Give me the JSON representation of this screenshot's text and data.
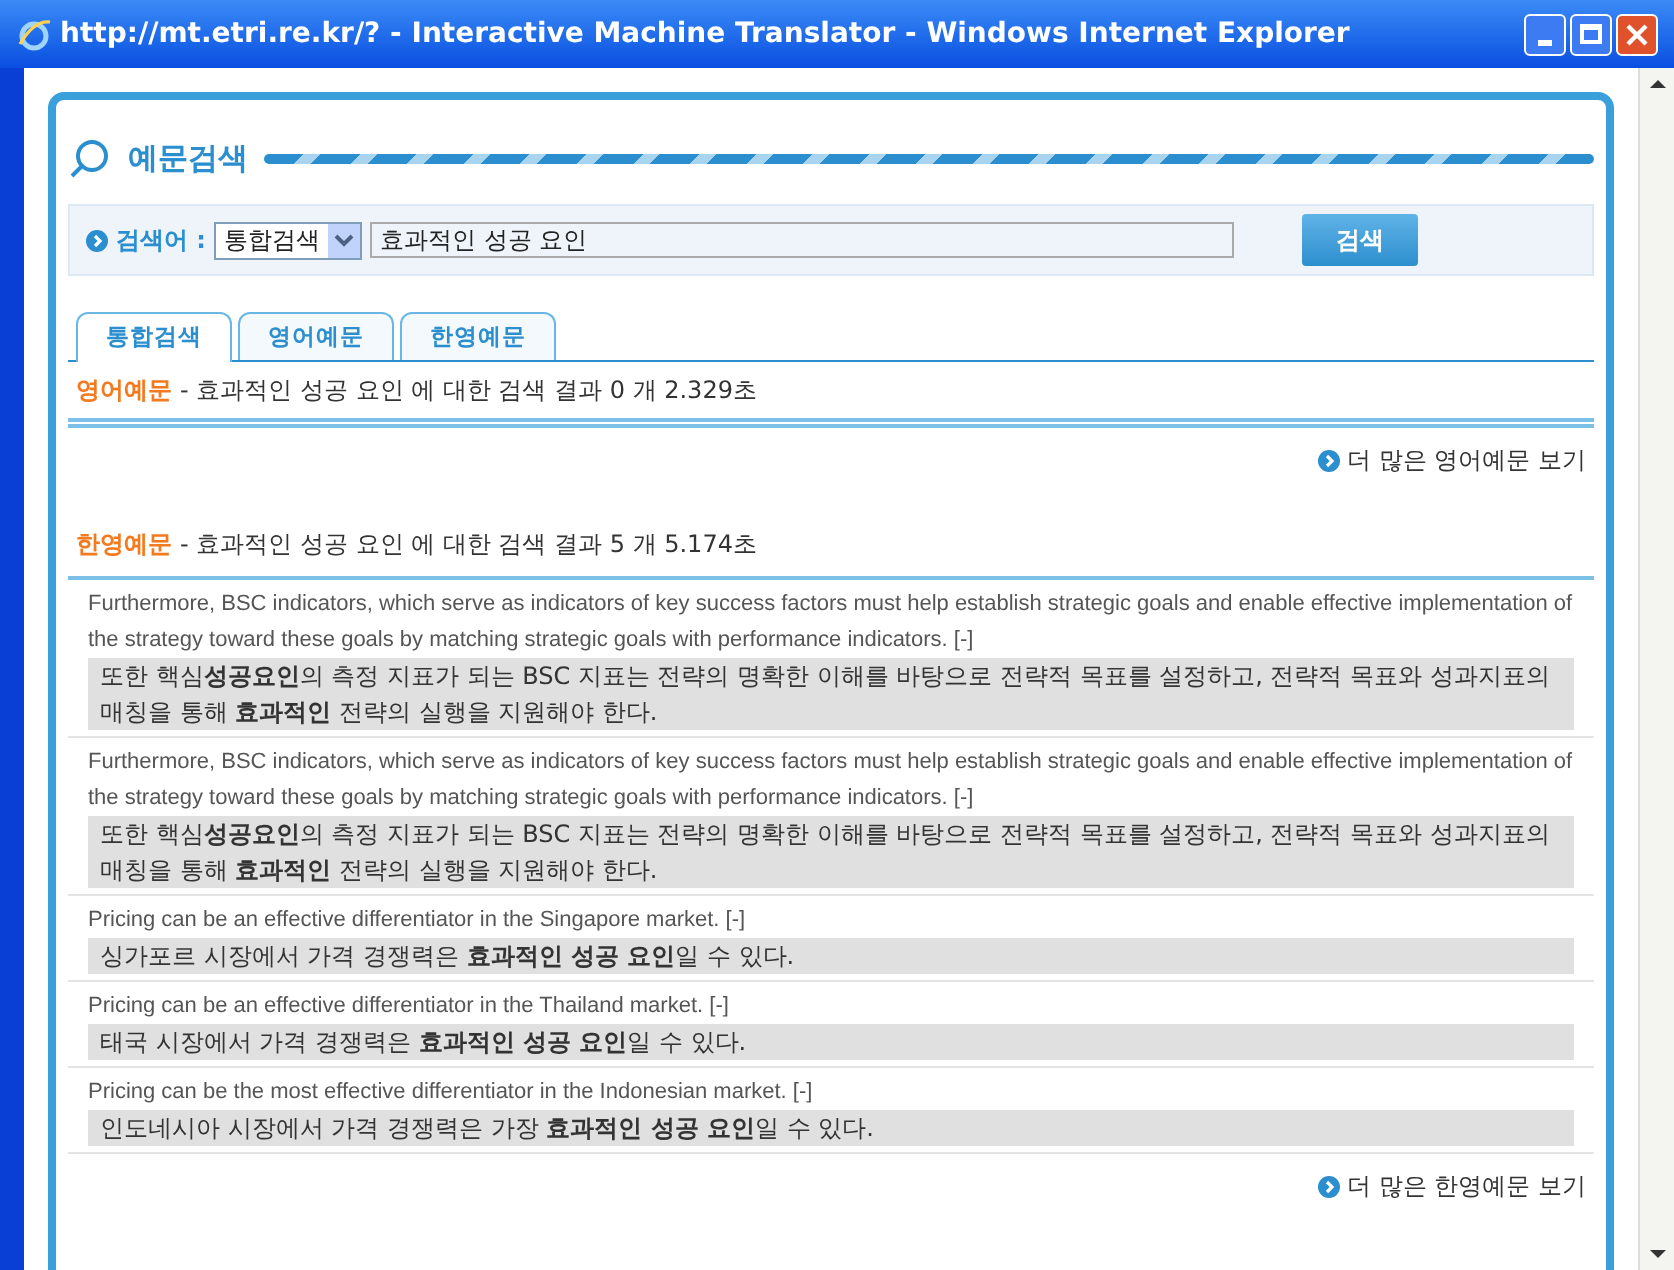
{
  "window": {
    "title": "http://mt.etri.re.kr/? - Interactive Machine Translator - Windows Internet Explorer"
  },
  "panel_title": "예문검색",
  "search": {
    "label": "검색어 :",
    "scope": "통합검색",
    "query": "효과적인 성공 요인",
    "button": "검색"
  },
  "tabs": [
    {
      "label": "통합검색",
      "selected": true
    },
    {
      "label": "영어예문",
      "selected": false
    },
    {
      "label": "한영예문",
      "selected": false
    }
  ],
  "sections": [
    {
      "title": "영어예문",
      "summary": "- 효과적인 성공 요인 에 대한 검색 결과 0 개 2.329초",
      "more": "더 많은 영어예문 보기"
    },
    {
      "title": "한영예문",
      "summary": "- 효과적인 성공 요인 에 대한 검색 결과 5 개 5.174초",
      "results": [
        {
          "english": "Furthermore, BSC indicators, which serve as indicators of key success factors must help establish strategic goals and enable effective implementation of the strategy toward these goals by matching strategic goals with performance indicators.",
          "toggle": "[-]",
          "korean": "또한 핵심**성공요인**의 측정 지표가 되는 BSC 지표는 전략의 명확한 이해를 바탕으로 전략적 목표를 설정하고, 전략적 목표와 성과지표의 매칭을 통해 **효과적인** 전략의 실행을 지원해야 한다."
        },
        {
          "english": "Furthermore, BSC indicators, which serve as indicators of key success factors must help establish strategic goals and enable effective implementation of the strategy toward these goals by matching strategic goals with performance indicators.",
          "toggle": "[-]",
          "korean": "또한 핵심**성공요인**의 측정 지표가 되는 BSC 지표는 전략의 명확한 이해를 바탕으로 전략적 목표를 설정하고, 전략적 목표와 성과지표의 매칭을 통해 **효과적인** 전략의 실행을 지원해야 한다."
        },
        {
          "english": "Pricing can be an effective differentiator in the Singapore market.",
          "toggle": "[-]",
          "korean": "싱가포르 시장에서 가격 경쟁력은 **효과적인 성공 요인**일 수 있다."
        },
        {
          "english": "Pricing can be an effective differentiator in the Thailand market.",
          "toggle": "[-]",
          "korean": "태국 시장에서 가격 경쟁력은 **효과적인 성공 요인**일 수 있다."
        },
        {
          "english": "Pricing can be the most effective differentiator in the Indonesian market.",
          "toggle": "[-]",
          "korean": "인도네시아 시장에서 가격 경쟁력은 가장 **효과적인 성공 요인**일 수 있다."
        }
      ],
      "more": "더 많은 한영예문 보기"
    }
  ]
}
